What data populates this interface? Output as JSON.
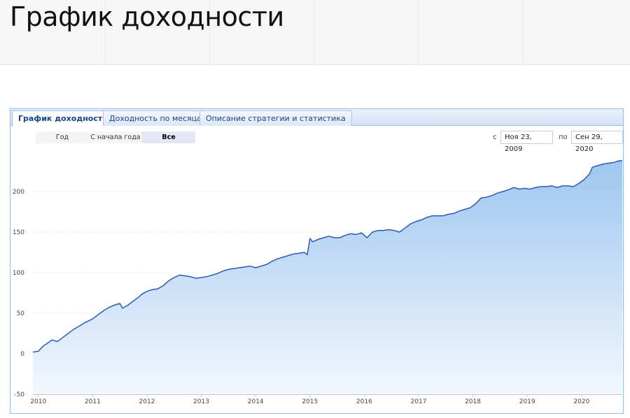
{
  "page": {
    "title": "График доходности"
  },
  "tabs": [
    {
      "label": "График доходности",
      "active": true
    },
    {
      "label": "Доходность по месяцам",
      "active": false
    },
    {
      "label": "Описание стратегии и статистика",
      "active": false
    }
  ],
  "range_buttons": [
    {
      "label": "Год",
      "active": false
    },
    {
      "label": "С начала года",
      "active": false
    },
    {
      "label": "Все",
      "active": true
    }
  ],
  "date_range": {
    "from_label": "с",
    "from_value": "Ноя 23, 2009",
    "to_label": "по",
    "to_value": "Сен 29, 2020"
  },
  "colors": {
    "line": "#2a5cb8",
    "fill_top": "#9ec6ef",
    "fill_bottom": "#f3f8fe",
    "accent": "#15428b"
  },
  "chart_data": {
    "type": "area",
    "ylim": [
      -50,
      250
    ],
    "yticks": [
      -50,
      0,
      50,
      100,
      150,
      200
    ],
    "xlim": [
      2009.9,
      2020.75
    ],
    "xticks": [
      2010,
      2011,
      2012,
      2013,
      2014,
      2015,
      2016,
      2017,
      2018,
      2019,
      2020
    ],
    "grid": true,
    "series": [
      {
        "x": [
          2009.9,
          2010.0,
          2010.1,
          2010.15,
          2010.25,
          2010.35,
          2010.45,
          2010.55,
          2010.65,
          2010.75,
          2010.85,
          2011.0,
          2011.1,
          2011.2,
          2011.3,
          2011.4,
          2011.5,
          2011.55,
          2011.65,
          2011.75,
          2011.85,
          2011.9,
          2012.0,
          2012.1,
          2012.2,
          2012.3,
          2012.4,
          2012.5,
          2012.6,
          2012.7,
          2012.8,
          2012.9,
          2013.0,
          2013.1,
          2013.2,
          2013.3,
          2013.4,
          2013.5,
          2013.6,
          2013.7,
          2013.8,
          2013.9,
          2014.0,
          2014.1,
          2014.2,
          2014.3,
          2014.4,
          2014.5,
          2014.6,
          2014.7,
          2014.8,
          2014.9,
          2014.95,
          2015.0,
          2015.05,
          2015.15,
          2015.25,
          2015.35,
          2015.45,
          2015.55,
          2015.65,
          2015.75,
          2015.85,
          2015.95,
          2016.05,
          2016.15,
          2016.25,
          2016.35,
          2016.45,
          2016.55,
          2016.65,
          2016.75,
          2016.85,
          2016.95,
          2017.05,
          2017.15,
          2017.25,
          2017.35,
          2017.45,
          2017.55,
          2017.65,
          2017.75,
          2017.85,
          2017.95,
          2018.05,
          2018.15,
          2018.25,
          2018.35,
          2018.45,
          2018.55,
          2018.65,
          2018.75,
          2018.85,
          2018.95,
          2019.05,
          2019.15,
          2019.25,
          2019.35,
          2019.45,
          2019.55,
          2019.65,
          2019.75,
          2019.85,
          2019.95,
          2020.05,
          2020.15,
          2020.2,
          2020.3,
          2020.4,
          2020.5,
          2020.6,
          2020.7,
          2020.75
        ],
        "values": [
          2,
          3,
          10,
          12,
          17,
          15,
          20,
          25,
          30,
          34,
          38,
          43,
          48,
          53,
          57,
          60,
          62,
          56,
          60,
          65,
          70,
          73,
          77,
          79,
          80,
          84,
          90,
          94,
          97,
          96,
          95,
          93,
          94,
          95,
          97,
          99,
          102,
          104,
          105,
          106,
          107,
          108,
          106,
          108,
          110,
          114,
          117,
          119,
          121,
          123,
          124,
          125,
          122,
          142,
          138,
          141,
          143,
          145,
          143,
          143,
          146,
          148,
          147,
          149,
          143,
          150,
          152,
          152,
          153,
          152,
          150,
          155,
          160,
          163,
          165,
          168,
          170,
          170,
          170,
          172,
          173,
          176,
          178,
          180,
          185,
          192,
          193,
          195,
          198,
          200,
          202,
          205,
          203,
          204,
          203,
          205,
          206,
          206,
          207,
          205,
          207,
          207,
          206,
          210,
          215,
          222,
          230,
          232,
          234,
          235,
          236,
          238,
          238
        ]
      }
    ]
  }
}
